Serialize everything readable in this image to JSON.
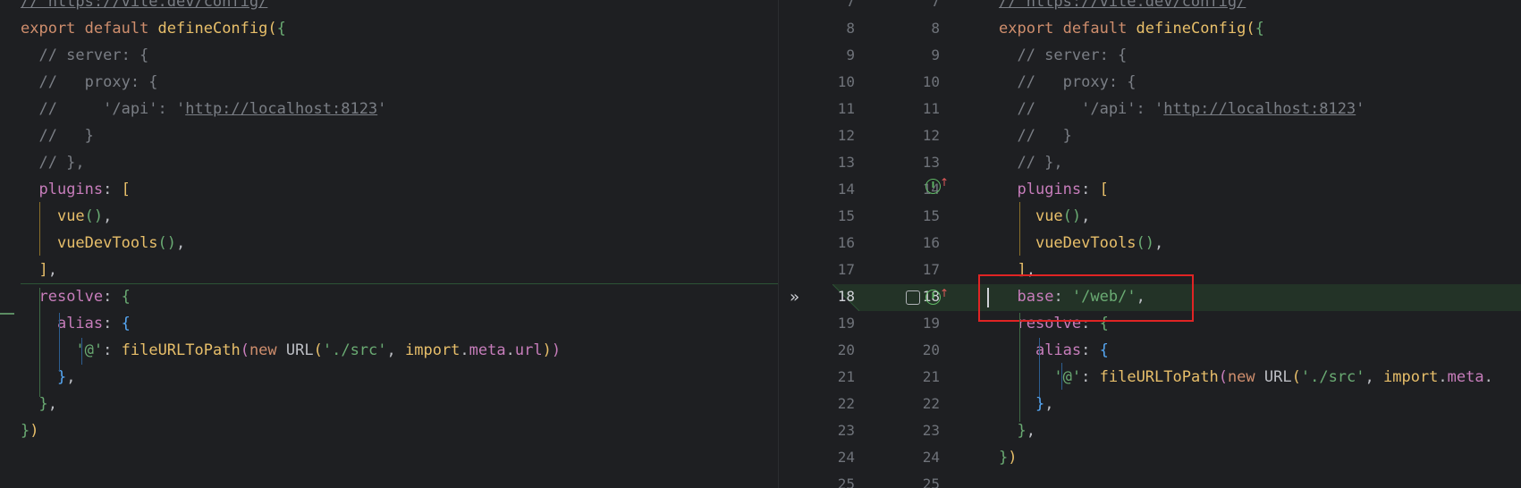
{
  "left_code": [
    {
      "parts": [
        [
          "cm-u",
          "// https://vite.dev/config/"
        ]
      ]
    },
    {
      "parts": [
        [
          "kw",
          "export "
        ],
        [
          "kw",
          "default "
        ],
        [
          "def",
          "defineConfig"
        ],
        [
          "b1",
          "("
        ],
        [
          "b2",
          "{"
        ]
      ]
    },
    {
      "parts": [
        [
          "cm",
          "  // server: {"
        ]
      ]
    },
    {
      "parts": [
        [
          "cm",
          "  //   proxy: {"
        ]
      ]
    },
    {
      "parts": [
        [
          "cm",
          "  //     '/api': '"
        ],
        [
          "cm-u",
          "http://localhost:8123"
        ],
        [
          "cm",
          "'"
        ]
      ]
    },
    {
      "parts": [
        [
          "cm",
          "  //   }"
        ]
      ]
    },
    {
      "parts": [
        [
          "cm",
          "  // },"
        ]
      ]
    },
    {
      "parts": [
        [
          "plain",
          "  "
        ],
        [
          "prop",
          "plugins"
        ],
        [
          "plain",
          ": "
        ],
        [
          "b1",
          "["
        ]
      ]
    },
    {
      "parts": [
        [
          "plain",
          "    "
        ],
        [
          "fnc",
          "vue"
        ],
        [
          "b2",
          "()"
        ],
        [
          "plain",
          ","
        ]
      ]
    },
    {
      "parts": [
        [
          "plain",
          "    "
        ],
        [
          "fnc",
          "vueDevTools"
        ],
        [
          "b2",
          "()"
        ],
        [
          "plain",
          ","
        ]
      ]
    },
    {
      "parts": [
        [
          "plain",
          "  "
        ],
        [
          "b1",
          "]"
        ],
        [
          "plain",
          ","
        ]
      ]
    },
    {
      "parts": [
        [
          "plain",
          "  "
        ],
        [
          "prop",
          "resolve"
        ],
        [
          "plain",
          ": "
        ],
        [
          "b2",
          "{"
        ]
      ]
    },
    {
      "parts": [
        [
          "plain",
          "    "
        ],
        [
          "prop",
          "alias"
        ],
        [
          "plain",
          ": "
        ],
        [
          "b3",
          "{"
        ]
      ]
    },
    {
      "parts": [
        [
          "plain",
          "      "
        ],
        [
          "str",
          "'@'"
        ],
        [
          "plain",
          ": "
        ],
        [
          "fnc",
          "fileURLToPath"
        ],
        [
          "b4",
          "("
        ],
        [
          "kw",
          "new "
        ],
        [
          "plain",
          "URL"
        ],
        [
          "b1",
          "("
        ],
        [
          "str",
          "'./src'"
        ],
        [
          "plain",
          ", "
        ],
        [
          "def",
          "import"
        ],
        [
          "plain",
          "."
        ],
        [
          "prop",
          "meta"
        ],
        [
          "plain",
          "."
        ],
        [
          "prop",
          "url"
        ],
        [
          "b1",
          ")"
        ],
        [
          "b4",
          ")"
        ]
      ]
    },
    {
      "parts": [
        [
          "plain",
          "    "
        ],
        [
          "b3",
          "}"
        ],
        [
          "plain",
          ","
        ]
      ]
    },
    {
      "parts": [
        [
          "plain",
          "  "
        ],
        [
          "b2",
          "}"
        ],
        [
          "plain",
          ","
        ]
      ]
    },
    {
      "parts": [
        [
          "b2",
          "}"
        ],
        [
          "b1",
          ")"
        ]
      ]
    }
  ],
  "right_code": [
    {
      "parts": [
        [
          "cm-u",
          "// https://vite.dev/config/"
        ]
      ]
    },
    {
      "parts": [
        [
          "kw",
          "export "
        ],
        [
          "kw",
          "default "
        ],
        [
          "def",
          "defineConfig"
        ],
        [
          "b1",
          "("
        ],
        [
          "b2",
          "{"
        ]
      ]
    },
    {
      "parts": [
        [
          "cm",
          "  // server: {"
        ]
      ]
    },
    {
      "parts": [
        [
          "cm",
          "  //   proxy: {"
        ]
      ]
    },
    {
      "parts": [
        [
          "cm",
          "  //     '/api': '"
        ],
        [
          "cm-u",
          "http://localhost:8123"
        ],
        [
          "cm",
          "'"
        ]
      ]
    },
    {
      "parts": [
        [
          "cm",
          "  //   }"
        ]
      ]
    },
    {
      "parts": [
        [
          "cm",
          "  // },"
        ]
      ]
    },
    {
      "parts": [
        [
          "plain",
          "  "
        ],
        [
          "prop",
          "plugins"
        ],
        [
          "plain",
          ": "
        ],
        [
          "b1",
          "["
        ]
      ]
    },
    {
      "parts": [
        [
          "plain",
          "    "
        ],
        [
          "fnc",
          "vue"
        ],
        [
          "b2",
          "()"
        ],
        [
          "plain",
          ","
        ]
      ]
    },
    {
      "parts": [
        [
          "plain",
          "    "
        ],
        [
          "fnc",
          "vueDevTools"
        ],
        [
          "b2",
          "()"
        ],
        [
          "plain",
          ","
        ]
      ]
    },
    {
      "parts": [
        [
          "plain",
          "  "
        ],
        [
          "b1",
          "]"
        ],
        [
          "plain",
          ","
        ]
      ]
    },
    {
      "parts": [
        [
          "plain",
          "  "
        ],
        [
          "prop",
          "base"
        ],
        [
          "plain",
          ": "
        ],
        [
          "str",
          "'/web/'"
        ],
        [
          "plain",
          ","
        ]
      ]
    },
    {
      "parts": [
        [
          "plain",
          "  "
        ],
        [
          "prop",
          "resolve"
        ],
        [
          "plain",
          ": "
        ],
        [
          "b2",
          "{"
        ]
      ]
    },
    {
      "parts": [
        [
          "plain",
          "    "
        ],
        [
          "prop",
          "alias"
        ],
        [
          "plain",
          ": "
        ],
        [
          "b3",
          "{"
        ]
      ]
    },
    {
      "parts": [
        [
          "plain",
          "      "
        ],
        [
          "str",
          "'@'"
        ],
        [
          "plain",
          ": "
        ],
        [
          "fnc",
          "fileURLToPath"
        ],
        [
          "b4",
          "("
        ],
        [
          "kw",
          "new "
        ],
        [
          "plain",
          "URL"
        ],
        [
          "b1",
          "("
        ],
        [
          "str",
          "'./src'"
        ],
        [
          "plain",
          ", "
        ],
        [
          "def",
          "import"
        ],
        [
          "plain",
          "."
        ],
        [
          "prop",
          "meta"
        ],
        [
          "plain",
          "."
        ]
      ]
    },
    {
      "parts": [
        [
          "plain",
          "    "
        ],
        [
          "b3",
          "}"
        ],
        [
          "plain",
          ","
        ]
      ]
    },
    {
      "parts": [
        [
          "plain",
          "  "
        ],
        [
          "b2",
          "}"
        ],
        [
          "plain",
          ","
        ]
      ]
    },
    {
      "parts": [
        [
          "b2",
          "}"
        ],
        [
          "b1",
          ")"
        ]
      ]
    }
  ],
  "gutter": {
    "left_numbers": [
      "7",
      "8",
      "9",
      "10",
      "11",
      "12",
      "13",
      "14",
      "15",
      "16",
      "17",
      "18",
      "19",
      "20",
      "21",
      "22",
      "23",
      "24",
      "25"
    ],
    "right_numbers": [
      "7",
      "8",
      "9",
      "10",
      "11",
      "12",
      "13",
      "14",
      "15",
      "16",
      "17",
      "18",
      "19",
      "20",
      "21",
      "22",
      "23",
      "24",
      "25"
    ],
    "apply_change_icon": "double-chevron-right-icon",
    "implements_icon_label": "I",
    "implements_arrow": "↑"
  },
  "colors": {
    "background": "#1e1f22",
    "added_line_bg": "#233327",
    "highlight_box": "#e02424"
  }
}
